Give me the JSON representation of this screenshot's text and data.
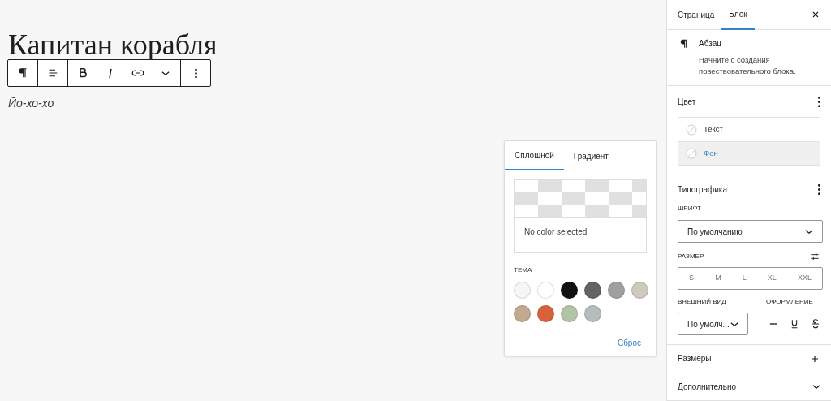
{
  "editor": {
    "title": "Капитан корабля",
    "paragraph": "Йо-хо-хо",
    "toolbar": [
      {
        "buttons": [
          {
            "kind": "paragraph"
          }
        ]
      },
      {
        "buttons": [
          {
            "kind": "align"
          }
        ]
      },
      {
        "buttons": [
          {
            "kind": "bold"
          },
          {
            "kind": "italic"
          },
          {
            "kind": "link"
          },
          {
            "kind": "more"
          }
        ]
      },
      {
        "buttons": [
          {
            "kind": "options"
          }
        ]
      }
    ]
  },
  "color_popover": {
    "tabs": [
      {
        "label": "Сплошной",
        "selected": true
      },
      {
        "label": "Градиент",
        "selected": false
      }
    ],
    "preview_text": "No color selected",
    "palette_label": "ТЕМА",
    "swatches": [
      {
        "color": "#f6f6f6"
      },
      {
        "color": "#ffffff"
      },
      {
        "color": "#111111"
      },
      {
        "color": "#636363"
      },
      {
        "color": "#a0a0a0"
      },
      {
        "color": "#cfcabe"
      },
      {
        "color": "#c2a990"
      },
      {
        "color": "#d8613c"
      },
      {
        "color": "#b1c5a4"
      },
      {
        "color": "#b5bdbc"
      }
    ],
    "reset": "Сброс"
  },
  "sidebar": {
    "tabs": [
      {
        "label": "Страница",
        "selected": false
      },
      {
        "label": "Блок",
        "selected": true
      }
    ],
    "block": {
      "name": "Абзац",
      "description": "Начните с создания повествовательного блока."
    },
    "color": {
      "title": "Цвет",
      "items": [
        {
          "label": "Текст",
          "selected": false
        },
        {
          "label": "Фон",
          "selected": true
        }
      ]
    },
    "typography": {
      "title": "Типографика",
      "font_label": "ШРИФТ",
      "font_value": "По умолчанию",
      "size_label": "РАЗМЕР",
      "sizes": [
        "S",
        "M",
        "L",
        "XL",
        "XXL"
      ],
      "appearance_label": "ВНЕШНИЙ ВИД",
      "appearance_value": "По умолч...",
      "decoration_label": "ОФОРМЛЕНИЕ",
      "decorations": [
        {
          "kind": "none"
        },
        {
          "kind": "underline"
        },
        {
          "kind": "strikethrough"
        }
      ]
    },
    "panels": [
      {
        "title": "Размеры",
        "kind": "add"
      },
      {
        "title": "Дополнительно",
        "kind": "expand"
      }
    ]
  }
}
